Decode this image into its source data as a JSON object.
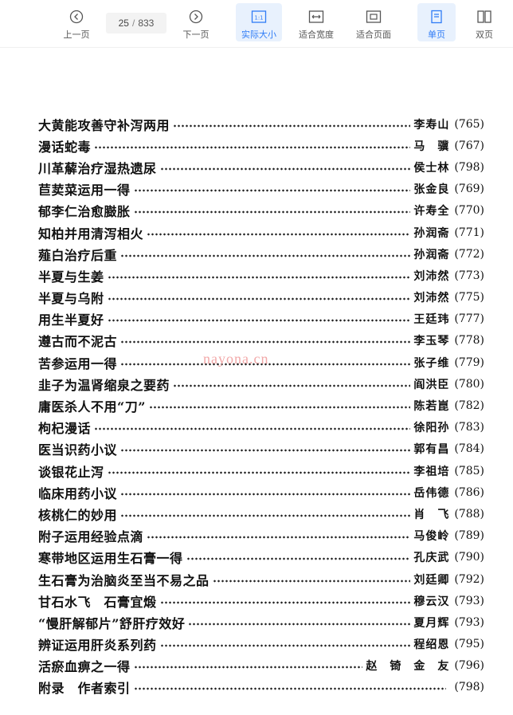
{
  "toolbar": {
    "prev_label": "上一页",
    "next_label": "下一页",
    "current_page": "25",
    "page_separator": "/",
    "total_pages": "833",
    "actual_size_label": "实际大小",
    "fit_width_label": "适合宽度",
    "fit_page_label": "适合页面",
    "single_page_label": "单页",
    "double_page_label": "双页",
    "accent_color": "#2f7cf6"
  },
  "watermark": "nayona.cn",
  "toc": [
    {
      "title": "大黄能攻善守补泻两用",
      "author": "李寿山",
      "page": "(765)"
    },
    {
      "title": "漫话蛇毒",
      "author": "马　骥",
      "page": "(767)"
    },
    {
      "title": "川革薢治疗湿热遗尿",
      "author": "侯士林",
      "page": "(798)"
    },
    {
      "title": "苣荬菜运用一得",
      "author": "张金良",
      "page": "(769)"
    },
    {
      "title": "郁李仁治愈臌胀",
      "author": "许寿全",
      "page": "(770)"
    },
    {
      "title": "知柏并用清泻相火",
      "author": "孙润斋",
      "page": "(771)"
    },
    {
      "title": "薤白治疗后重",
      "author": "孙润斋",
      "page": "(772)"
    },
    {
      "title": "半夏与生姜",
      "author": "刘沛然",
      "page": "(773)"
    },
    {
      "title": "半夏与乌附",
      "author": "刘沛然",
      "page": "(775)"
    },
    {
      "title": "用生半夏好",
      "author": "王廷玮",
      "page": "(777)"
    },
    {
      "title": "遵古而不泥古",
      "author": "李玉琴",
      "page": "(778)"
    },
    {
      "title": "苦参运用一得",
      "author": "张子维",
      "page": "(779)"
    },
    {
      "title": "韭子为温肾缩泉之要药",
      "author": "阎洪臣",
      "page": "(780)"
    },
    {
      "title": "庸医杀人不用“刀”",
      "author": "陈若崑",
      "page": "(782)"
    },
    {
      "title": "枸杞漫话",
      "author": "徐阳孙",
      "page": "(783)"
    },
    {
      "title": "医当识药小议",
      "author": "郭有昌",
      "page": "(784)"
    },
    {
      "title": "谈银花止泻",
      "author": "李祖培",
      "page": "(785)"
    },
    {
      "title": "临床用药小议",
      "author": "岳伟德",
      "page": "(786)"
    },
    {
      "title": "核桃仁的妙用",
      "author": "肖　飞",
      "page": "(788)"
    },
    {
      "title": "附子运用经验点滴",
      "author": "马俊岭",
      "page": "(789)"
    },
    {
      "title": "寒带地区运用生石膏一得",
      "author": "孔庆武",
      "page": "(790)"
    },
    {
      "title": "生石膏为治脑炎至当不易之品",
      "author": "刘廷卿",
      "page": "(792)"
    },
    {
      "title": "甘石水飞　石膏宜煅",
      "author": "穆云汉",
      "page": "(793)"
    },
    {
      "title": "“慢肝解郁片”舒肝疗效好",
      "author": "夏月辉",
      "page": "(793)"
    },
    {
      "title": "辨证运用肝炎系列药",
      "author": "程绍恩",
      "page": "(795)"
    },
    {
      "title": "活瘀血痹之一得",
      "author": "赵　锜　金　友",
      "page": "(796)"
    },
    {
      "title": "附录　作者索引",
      "author": "",
      "page": "(798)"
    }
  ]
}
